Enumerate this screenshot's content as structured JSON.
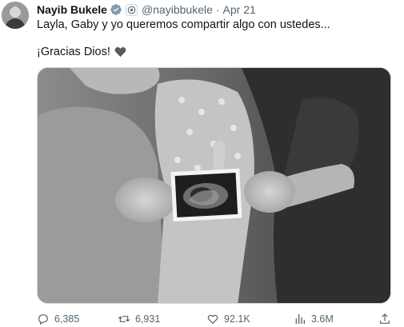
{
  "author": {
    "name": "Nayib Bukele",
    "handle": "@nayibbukele",
    "separator": "·",
    "date": "Apr 21"
  },
  "icons": {
    "verified": "verified-badge-icon",
    "affiliation": "government-affiliation-icon",
    "heart_emoji": "black-heart-icon",
    "reply": "reply-icon",
    "retweet": "retweet-icon",
    "like": "like-icon",
    "views": "views-icon",
    "share": "share-icon"
  },
  "tweet": {
    "line1": "Layla, Gaby y yo queremos compartir algo con ustedes...",
    "line2": "¡Gracias Dios!"
  },
  "metrics": {
    "replies": "6,385",
    "retweets": "6,931",
    "likes": "92.1K",
    "views": "3.6M"
  },
  "colors": {
    "text": "#0f1419",
    "secondary": "#536471",
    "verified": "#1d9bf0"
  }
}
